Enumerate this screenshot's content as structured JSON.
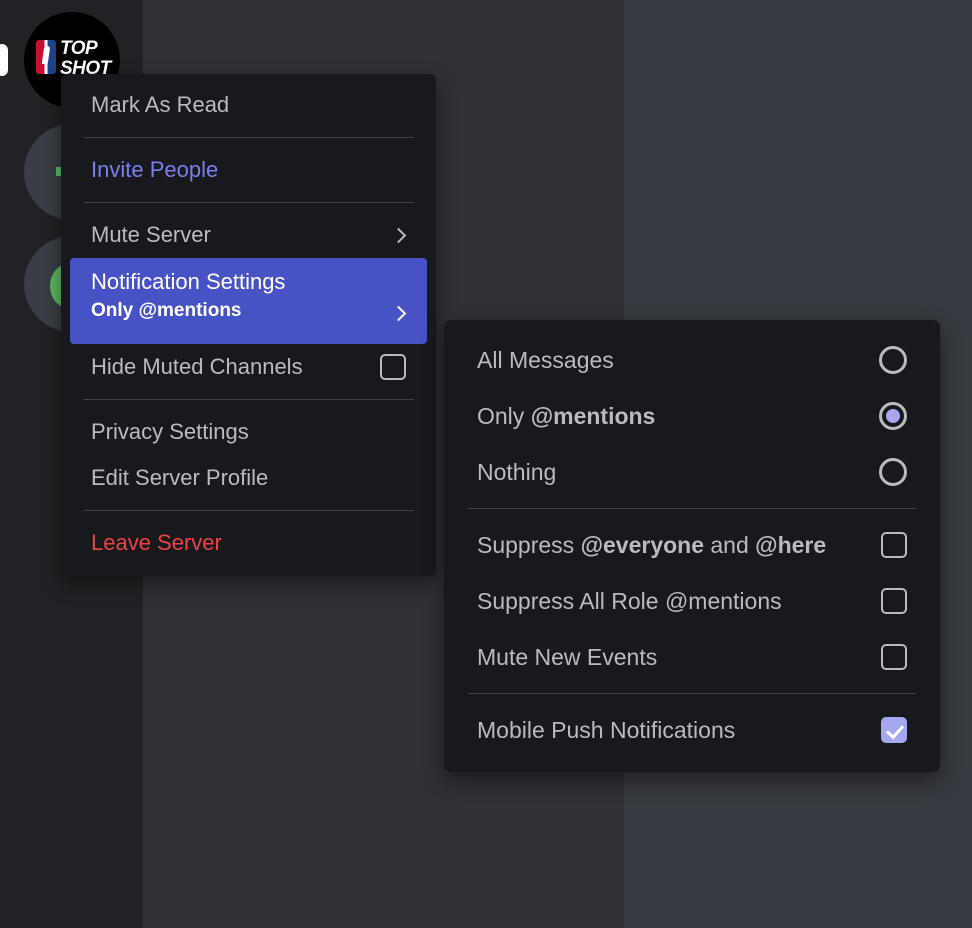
{
  "background": {
    "server_rail": {
      "active_indicator": "active-server-pill",
      "servers": [
        {
          "name": "NBA Top Shot",
          "logo_text_line1": "TOP",
          "logo_text_line2": "SHOT",
          "badge": "nba-logo"
        },
        {
          "name": "server-2",
          "badge": "green-status"
        },
        {
          "name": "server-3",
          "badge": "green-status"
        }
      ]
    }
  },
  "context_menu": {
    "items": [
      {
        "id": "mark-as-read",
        "label": "Mark As Read",
        "style": "default",
        "trailing": "none"
      },
      {
        "id": "separator-1",
        "type": "separator"
      },
      {
        "id": "invite-people",
        "label": "Invite People",
        "style": "link",
        "trailing": "none"
      },
      {
        "id": "separator-2",
        "type": "separator"
      },
      {
        "id": "mute-server",
        "label": "Mute Server",
        "style": "default",
        "trailing": "chevron"
      },
      {
        "id": "notification-settings",
        "label": "Notification Settings",
        "subtitle": "Only @mentions",
        "style": "selected",
        "trailing": "chevron"
      },
      {
        "id": "hide-muted-channels",
        "label": "Hide Muted Channels",
        "style": "default",
        "trailing": "checkbox",
        "checked": false
      },
      {
        "id": "separator-3",
        "type": "separator"
      },
      {
        "id": "privacy-settings",
        "label": "Privacy Settings",
        "style": "default",
        "trailing": "none"
      },
      {
        "id": "edit-server-profile",
        "label": "Edit Server Profile",
        "style": "default",
        "trailing": "none"
      },
      {
        "id": "separator-4",
        "type": "separator"
      },
      {
        "id": "leave-server",
        "label": "Leave Server",
        "style": "danger",
        "trailing": "none"
      }
    ]
  },
  "notification_submenu": {
    "radio_options": [
      {
        "id": "all-messages",
        "label": "All Messages",
        "selected": false
      },
      {
        "id": "only-mentions",
        "label_plain": "Only ",
        "label_bold": "@mentions",
        "selected": true
      },
      {
        "id": "nothing",
        "label": "Nothing",
        "selected": false
      }
    ],
    "toggles": [
      {
        "id": "suppress-everyone-here",
        "part1": "Suppress ",
        "part2": "@everyone",
        "part3": " and ",
        "part4": "@here",
        "checked": false
      },
      {
        "id": "suppress-all-role-mentions",
        "part1": "Suppress All Role ",
        "part2": "@mentions",
        "checked": false
      },
      {
        "id": "mute-new-events",
        "label": "Mute New Events",
        "checked": false
      }
    ],
    "mobile_push": {
      "id": "mobile-push-notifications",
      "label": "Mobile Push Notifications",
      "checked": true
    }
  },
  "colors": {
    "menu_background": "#18191c",
    "highlight_blurple": "#4752c4",
    "link_blurple": "#7a7ff0",
    "danger_red": "#ed4245",
    "control_accent": "#a5a8f0",
    "text_muted": "#b9bbbe"
  }
}
